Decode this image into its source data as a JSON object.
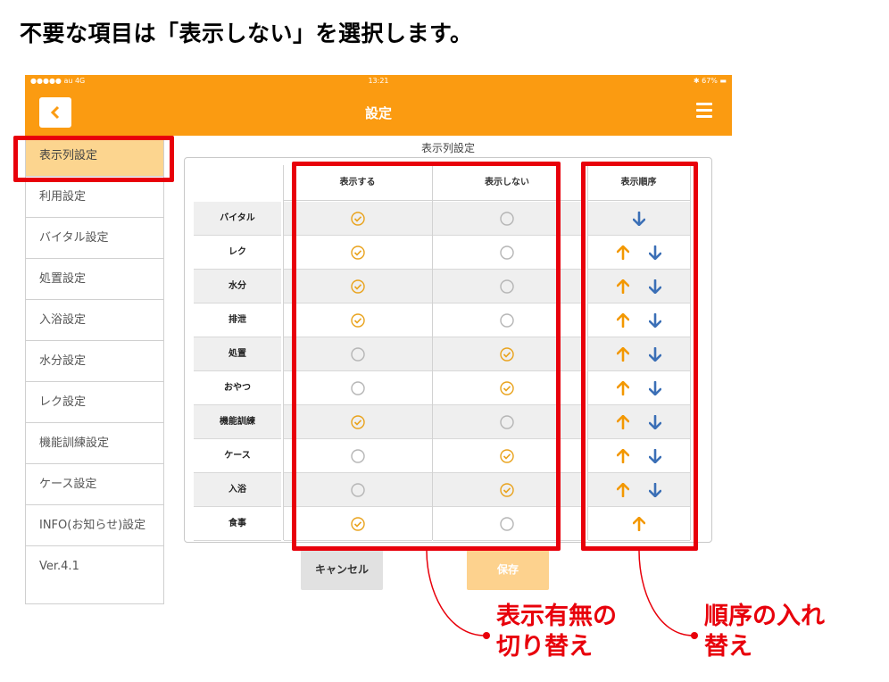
{
  "heading": "不要な項目は「表示しない」を選択します。",
  "statusbar": {
    "carrier": "●●●●● au  4G",
    "time": "13:21",
    "battery": "✱ 67% ▬"
  },
  "navbar": {
    "title": "設定"
  },
  "sidebar": {
    "items": [
      {
        "label": "表示列設定",
        "active": true
      },
      {
        "label": "利用設定"
      },
      {
        "label": "バイタル設定"
      },
      {
        "label": "処置設定"
      },
      {
        "label": "入浴設定"
      },
      {
        "label": "水分設定"
      },
      {
        "label": "レク設定"
      },
      {
        "label": "機能訓練設定"
      },
      {
        "label": "ケース設定"
      },
      {
        "label": "INFO(お知らせ)設定"
      },
      {
        "label": "Ver.4.1"
      }
    ]
  },
  "section_title": "表示列設定",
  "table": {
    "headers": {
      "show": "表示する",
      "hide": "表示しない",
      "order": "表示順序"
    },
    "rows": [
      {
        "label": "バイタル",
        "selected": "show",
        "up": false,
        "down": true
      },
      {
        "label": "レク",
        "selected": "show",
        "up": true,
        "down": true
      },
      {
        "label": "水分",
        "selected": "show",
        "up": true,
        "down": true
      },
      {
        "label": "排泄",
        "selected": "show",
        "up": true,
        "down": true
      },
      {
        "label": "処置",
        "selected": "hide",
        "up": true,
        "down": true
      },
      {
        "label": "おやつ",
        "selected": "hide",
        "up": true,
        "down": true
      },
      {
        "label": "機能訓練",
        "selected": "show",
        "up": true,
        "down": true
      },
      {
        "label": "ケース",
        "selected": "hide",
        "up": true,
        "down": true
      },
      {
        "label": "入浴",
        "selected": "hide",
        "up": true,
        "down": true
      },
      {
        "label": "食事",
        "selected": "show",
        "up": true,
        "down": false
      }
    ]
  },
  "buttons": {
    "cancel": "キャンセル",
    "save": "保存"
  },
  "callouts": {
    "toggle": [
      "表示有無の",
      "切り替え"
    ],
    "order": [
      "順序の入れ",
      "替え"
    ]
  },
  "colors": {
    "accent": "#fb9b11",
    "highlight": "#e8000b",
    "arrow_up": "#f39800",
    "arrow_down": "#3b6fb6",
    "radio_on": "#e9a21b",
    "radio_off": "#b5b5b5"
  }
}
